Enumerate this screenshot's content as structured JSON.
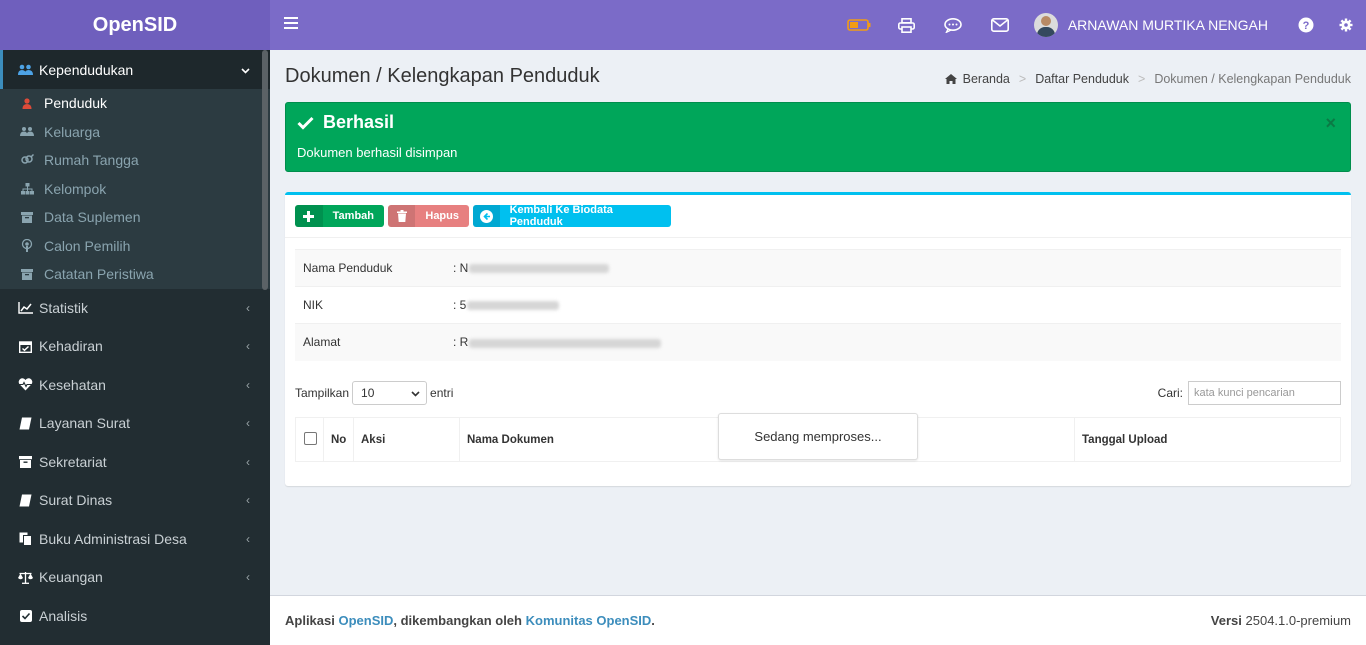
{
  "app": {
    "logo": "OpenSID"
  },
  "topbar": {
    "user_name": "ARNAWAN MURTIKA NENGAH",
    "icons": [
      "battery-icon",
      "print-icon",
      "chat-icon",
      "mail-icon",
      "help-icon",
      "gear-icon"
    ],
    "battery_color": "#f39c12"
  },
  "sidebar": {
    "active_section": {
      "label": "Kependudukan",
      "icon": "users-icon"
    },
    "submenu": [
      {
        "label": "Penduduk",
        "icon": "user-icon",
        "active": true
      },
      {
        "label": "Keluarga",
        "icon": "users-icon"
      },
      {
        "label": "Rumah Tangga",
        "icon": "venus-mars-icon"
      },
      {
        "label": "Kelompok",
        "icon": "sitemap-icon"
      },
      {
        "label": "Data Suplemen",
        "icon": "archive-icon"
      },
      {
        "label": "Calon Pemilih",
        "icon": "podcast-icon"
      },
      {
        "label": "Catatan Peristiwa",
        "icon": "archive-icon"
      }
    ],
    "items": [
      {
        "label": "Statistik",
        "icon": "chart-icon"
      },
      {
        "label": "Kehadiran",
        "icon": "calendar-icon"
      },
      {
        "label": "Kesehatan",
        "icon": "heartbeat-icon"
      },
      {
        "label": "Layanan Surat",
        "icon": "book-icon"
      },
      {
        "label": "Sekretariat",
        "icon": "archive-icon"
      },
      {
        "label": "Surat Dinas",
        "icon": "book-icon"
      },
      {
        "label": "Buku Administrasi Desa",
        "icon": "copy-icon"
      },
      {
        "label": "Keuangan",
        "icon": "balance-scale-icon"
      },
      {
        "label": "Analisis",
        "icon": "check-square-icon"
      }
    ]
  },
  "page": {
    "title": "Dokumen / Kelengkapan Penduduk",
    "breadcrumb": [
      "Beranda",
      "Daftar Penduduk",
      "Dokumen / Kelengkapan Penduduk"
    ]
  },
  "alert": {
    "title": "Berhasil",
    "message": "Dokumen berhasil disimpan",
    "color": "#00a65a"
  },
  "toolbar": {
    "add": "Tambah",
    "delete": "Hapus",
    "back": "Kembali Ke Biodata Penduduk"
  },
  "info": [
    {
      "label": "Nama Penduduk",
      "value": ": N"
    },
    {
      "label": "NIK",
      "value": ": 5"
    },
    {
      "label": "Alamat",
      "value": ": R"
    }
  ],
  "table": {
    "show_label": "Tampilkan",
    "page_size": "10",
    "entries_label": "entri",
    "search_label": "Cari:",
    "search_placeholder": "kata kunci pencarian",
    "columns": [
      "No",
      "Aksi",
      "Nama Dokumen",
      "Tanggal Upload"
    ],
    "processing": "Sedang memproses..."
  },
  "footer": {
    "app_label": "Aplikasi",
    "app_link": "OpenSID",
    "dev_label": ", dikembangkan oleh",
    "community_link": "Komunitas OpenSID",
    "period": ".",
    "version_label": "Versi",
    "version": "2504.1.0-premium"
  }
}
